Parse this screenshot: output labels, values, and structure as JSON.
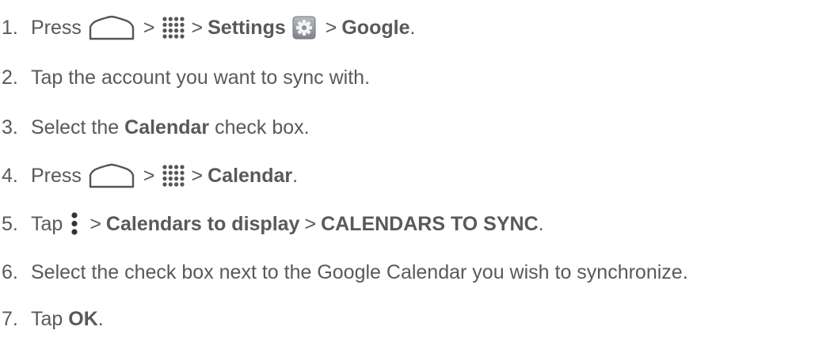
{
  "steps": [
    {
      "num": "1.",
      "press": "Press",
      "gt1": ">",
      "gt2": ">",
      "settings": "Settings",
      "gt3": ">",
      "google": "Google",
      "end": "."
    },
    {
      "num": "2.",
      "text": "Tap the account you want to sync with."
    },
    {
      "num": "3.",
      "pre": "Select the",
      "bold": "Calendar",
      "post": "check box."
    },
    {
      "num": "4.",
      "press": "Press",
      "gt1": ">",
      "gt2": ">",
      "calendar": "Calendar",
      "end": "."
    },
    {
      "num": "5.",
      "tap": "Tap",
      "gt1": ">",
      "display": "Calendars to display",
      "gt2": ">",
      "sync": "CALENDARS TO SYNC",
      "end": "."
    },
    {
      "num": "6.",
      "text": "Select the check box next to the Google Calendar you wish to synchronize."
    },
    {
      "num": "7.",
      "tap": "Tap",
      "ok": "OK",
      "end": "."
    }
  ],
  "icons": {
    "home": "home-icon",
    "apps": "apps-icon",
    "settings": "settings-icon",
    "menu": "menu-icon"
  },
  "colors": {
    "text": "#595959",
    "icon": "#555555"
  }
}
